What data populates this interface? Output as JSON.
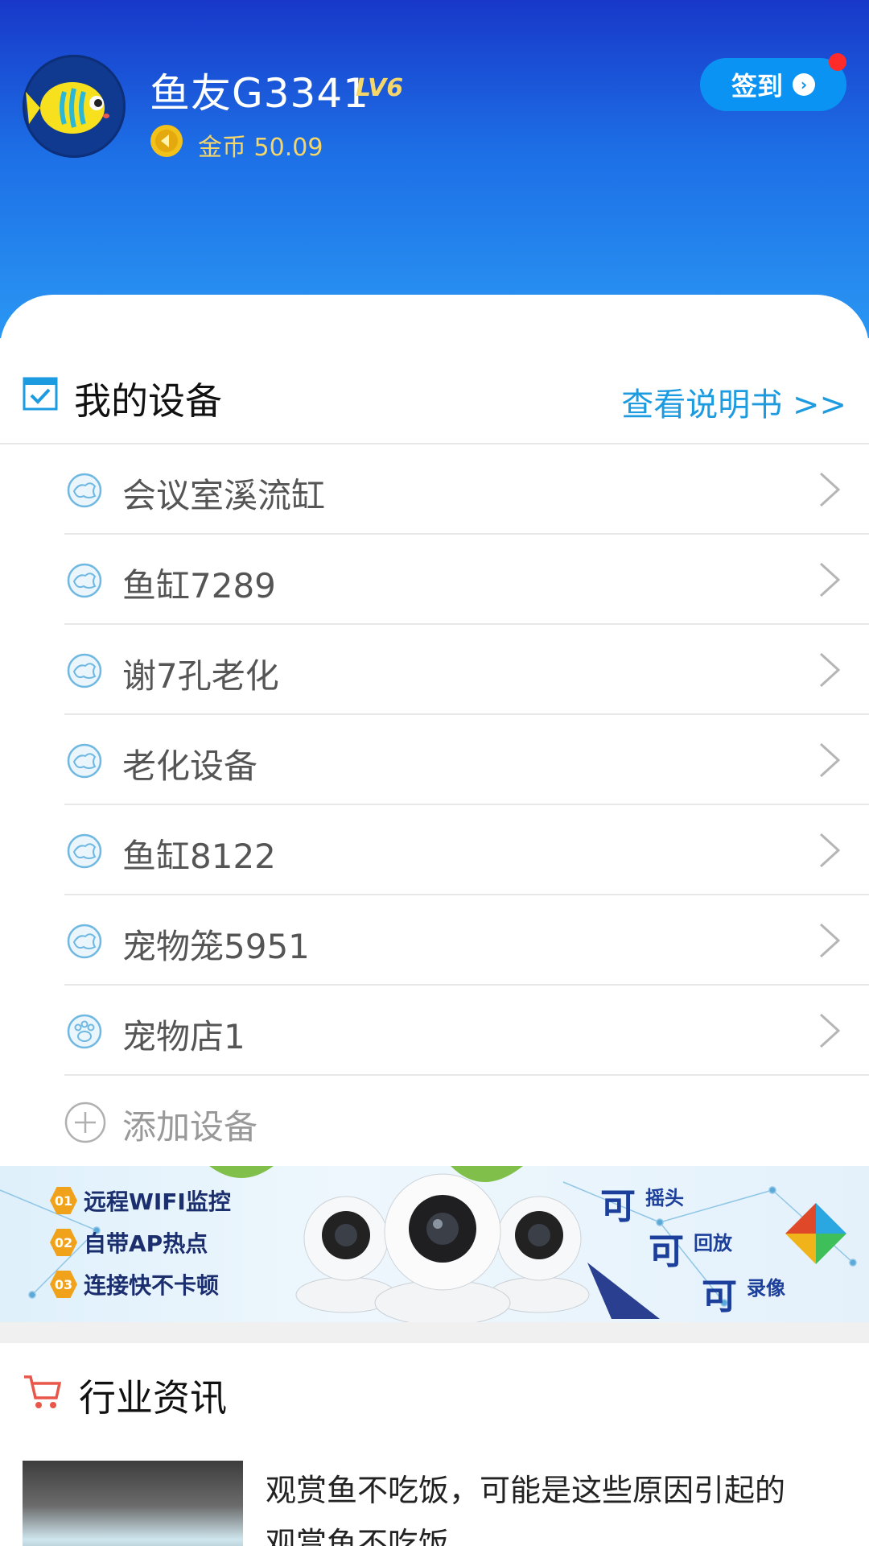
{
  "profile": {
    "username": "鱼友G3341",
    "level": "LV6",
    "coins_label": "金币 50.09",
    "checkin_label": "签到"
  },
  "devices_section": {
    "title": "我的设备",
    "manual_link": "查看说明书 >>",
    "items": [
      {
        "label": "会议室溪流缸",
        "icon": "fish-tank-icon"
      },
      {
        "label": "鱼缸7289",
        "icon": "fish-tank-icon"
      },
      {
        "label": "谢7孔老化",
        "icon": "fish-tank-icon"
      },
      {
        "label": "老化设备",
        "icon": "fish-tank-icon"
      },
      {
        "label": "鱼缸8122",
        "icon": "fish-tank-icon"
      },
      {
        "label": "宠物笼5951",
        "icon": "fish-tank-icon"
      },
      {
        "label": "宠物店1",
        "icon": "paw-icon"
      }
    ],
    "add_label": "添加设备"
  },
  "banner": {
    "features": [
      {
        "num": "01",
        "text": "远程WIFI监控"
      },
      {
        "num": "02",
        "text": "自带AP热点"
      },
      {
        "num": "03",
        "text": "连接快不卡顿"
      }
    ],
    "ke": "可",
    "slogans": [
      "摇头",
      "回放",
      "录像"
    ]
  },
  "news": {
    "title": "行业资讯",
    "headline": "观赏鱼不吃饭，可能是这些原因引起的",
    "subline": "观赏鱼不吃饭"
  },
  "colors": {
    "header_top": "#1838c9",
    "header_bottom": "#2a97f3",
    "accent": "#1c9be0",
    "gold": "#f4d66b"
  }
}
